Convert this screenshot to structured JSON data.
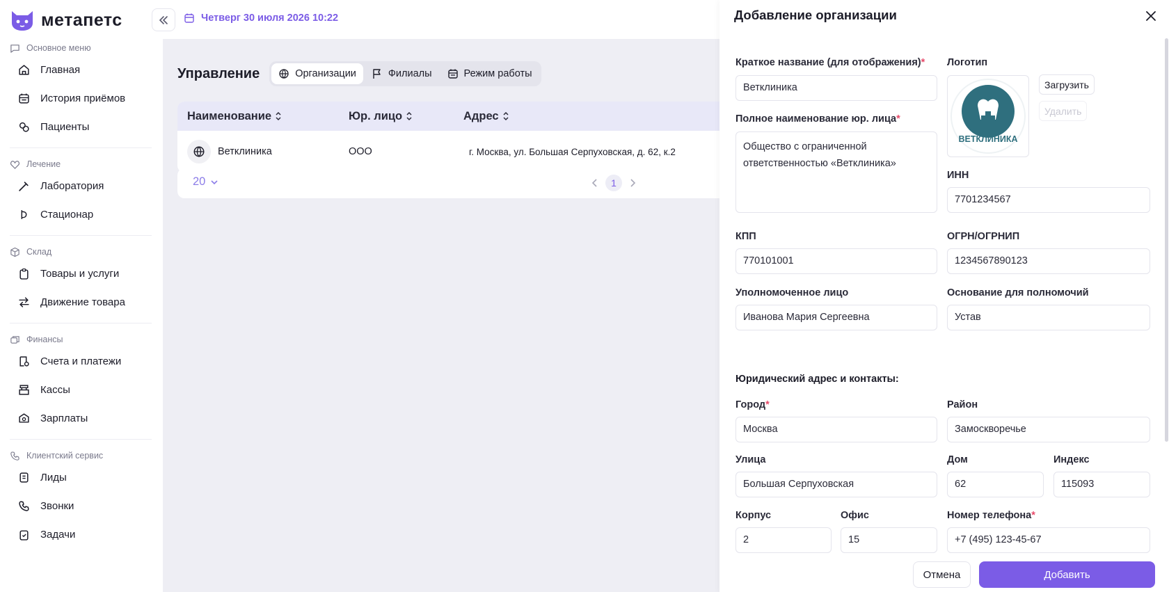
{
  "app": {
    "brand": "метапетс",
    "accent": "#7b5ce6"
  },
  "topbar": {
    "date": "Четверг 30 июля 2026 10:22"
  },
  "sidebar": {
    "sections": [
      {
        "title": "Основное меню",
        "icon": "message-icon",
        "items": [
          {
            "label": "Главная",
            "icon": "home-icon"
          },
          {
            "label": "История приёмов",
            "icon": "calendar-icon"
          },
          {
            "label": "Пациенты",
            "icon": "paw-icon"
          }
        ]
      },
      {
        "title": "Лечение",
        "icon": "heart-icon",
        "items": [
          {
            "label": "Лаборатория",
            "icon": "pipette-icon"
          },
          {
            "label": "Стационар",
            "icon": "bed-icon"
          }
        ]
      },
      {
        "title": "Склад",
        "icon": "box-icon",
        "items": [
          {
            "label": "Товары и услуги",
            "icon": "clipboard-icon"
          },
          {
            "label": "Движение товара",
            "icon": "transfer-icon"
          }
        ]
      },
      {
        "title": "Финансы",
        "icon": "coins-icon",
        "items": [
          {
            "label": "Счета и платежи",
            "icon": "receipt-icon"
          },
          {
            "label": "Кассы",
            "icon": "cashbox-icon"
          },
          {
            "label": "Зарплаты",
            "icon": "wallet-icon"
          }
        ]
      },
      {
        "title": "Клиентский сервис",
        "icon": "phone-icon",
        "items": [
          {
            "label": "Лиды",
            "icon": "lead-icon"
          },
          {
            "label": "Звонки",
            "icon": "phone-icon"
          },
          {
            "label": "Задачи",
            "icon": "tasks-icon"
          }
        ]
      }
    ]
  },
  "main": {
    "title": "Управление",
    "tabs": [
      {
        "label": "Организации",
        "icon": "globe-icon",
        "active": true
      },
      {
        "label": "Филиалы",
        "icon": "flag-icon",
        "active": false
      },
      {
        "label": "Режим работы",
        "icon": "calendar-icon",
        "active": false
      }
    ],
    "table": {
      "columns": [
        "Наименование",
        "Юр. лицо",
        "Адрес"
      ],
      "rows": [
        {
          "name": "Ветклиника",
          "legal": "ООО",
          "address": "г. Москва, ул. Большая Серпуховская, д. 62, к.2"
        }
      ]
    },
    "pagination": {
      "page_size": "20",
      "current_page": "1"
    }
  },
  "drawer": {
    "title": "Добавление организации",
    "short_name": {
      "label": "Краткое название (для отображения)",
      "value": "Ветклиника"
    },
    "logo": {
      "label": "Логотип",
      "upload": "Загрузить",
      "delete": "Удалить",
      "logo_text": "ВЕТКЛИНИКА"
    },
    "full_name": {
      "label": "Полное наименование юр. лица",
      "value": "Общество с ограниченной ответственностью «Ветклиника»"
    },
    "inn": {
      "label": "ИНН",
      "value": "7701234567"
    },
    "kpp": {
      "label": "КПП",
      "value": "770101001"
    },
    "ogrn": {
      "label": "ОГРН/ОГРНИП",
      "value": "1234567890123"
    },
    "person": {
      "label": "Уполномоченное лицо",
      "value": "Иванова Мария Сергеевна"
    },
    "basis": {
      "label": "Основание для полномочий",
      "value": "Устав"
    },
    "address_heading": "Юридический адрес и контакты:",
    "city": {
      "label": "Город",
      "value": "Москва"
    },
    "district": {
      "label": "Район",
      "value": "Замоскворечье"
    },
    "street": {
      "label": "Улица",
      "value": "Большая Серпуховская"
    },
    "house": {
      "label": "Дом",
      "value": "62"
    },
    "index": {
      "label": "Индекс",
      "value": "115093"
    },
    "building": {
      "label": "Корпус",
      "value": "2"
    },
    "office": {
      "label": "Офис",
      "value": "15"
    },
    "phone": {
      "label": "Номер телефона",
      "value": "+7 (495) 123-45-67"
    },
    "cancel": "Отмена",
    "submit": "Добавить"
  }
}
